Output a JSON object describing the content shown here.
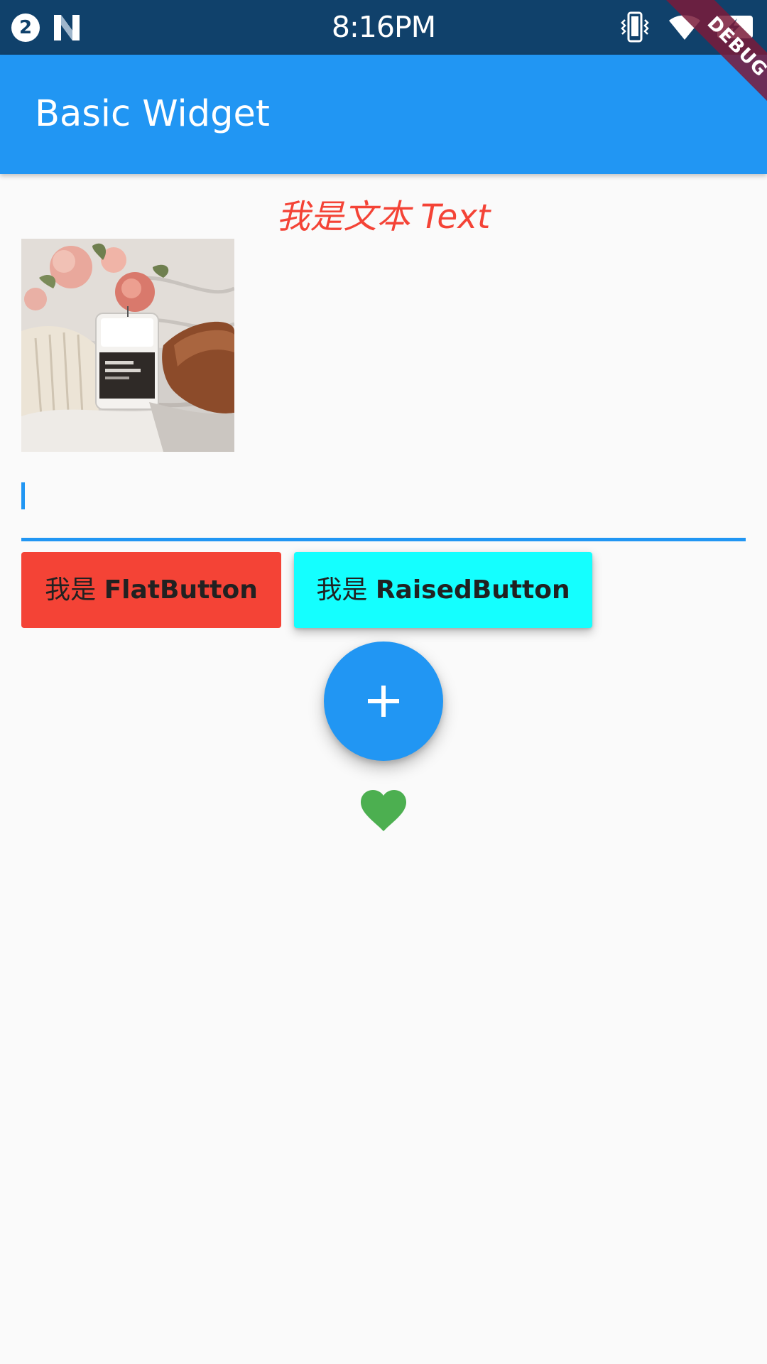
{
  "status_bar": {
    "notification_count": "2",
    "time": "8:16PM",
    "icons": [
      "notification-badge-icon",
      "n-logo-icon",
      "vibrate-icon",
      "wifi-icon",
      "battery-charging-icon"
    ]
  },
  "app_bar": {
    "title": "Basic Widget",
    "color": "#2196f3"
  },
  "debug_banner": {
    "label": "DEBUG"
  },
  "content": {
    "hero_text": "我是文本 Text",
    "hero_text_color": "#f44336",
    "image": {
      "description": "photo-icon"
    },
    "text_field": {
      "value": "",
      "focused": true
    },
    "flat_button": {
      "prefix": "我是",
      "label": "FlatButton",
      "color": "#f44336"
    },
    "raised_button": {
      "prefix": "我是",
      "label": "RaisedButton",
      "color": "#14ffff"
    },
    "fab": {
      "icon": "plus-icon",
      "color": "#2196f3"
    },
    "favorite": {
      "icon": "heart-icon",
      "color": "#4caf50"
    }
  }
}
